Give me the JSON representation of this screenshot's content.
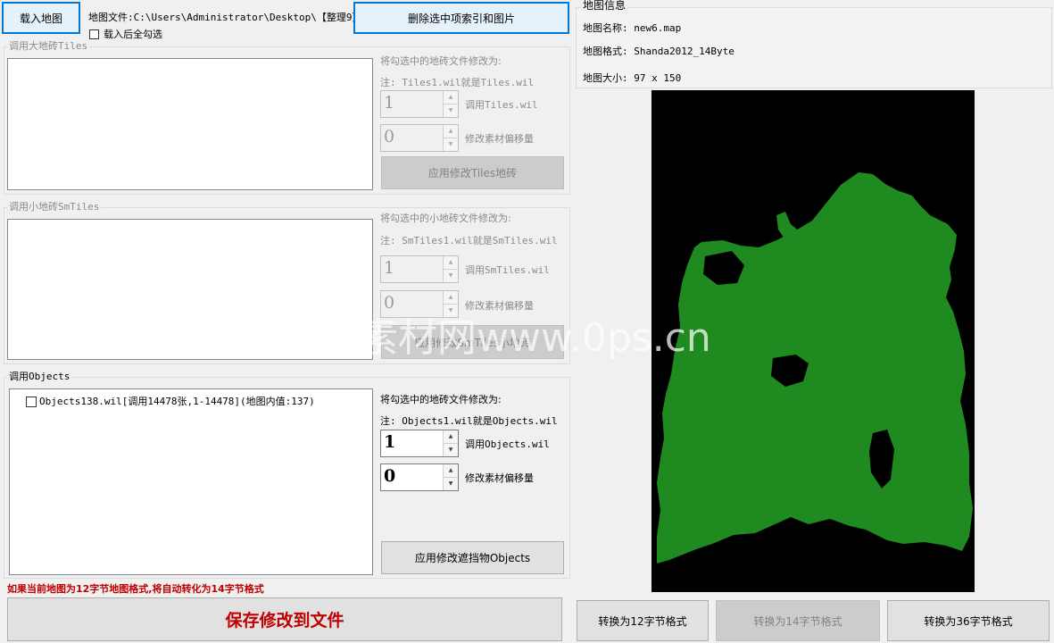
{
  "toolbar": {
    "load_map_label": "载入地图",
    "map_file_label": "地图文件:C:\\Users\\Administrator\\Desktop\\【整理9】:",
    "delete_label": "删除选中项索引和图片",
    "select_all_label": "载入后全勾选"
  },
  "tiles": {
    "legend": "调用大地砖Tiles",
    "modify_label": "将勾选中的地砖文件修改为:",
    "note": "注: Tiles1.wil就是Tiles.wil",
    "index_value": "1",
    "index_label": "调用Tiles.wil",
    "offset_value": "0",
    "offset_label": "修改素材偏移量",
    "apply_label": "应用修改Tiles地砖"
  },
  "smtiles": {
    "legend": "调用小地砖SmTiles",
    "modify_label": "将勾选中的小地砖文件修改为:",
    "note": "注: SmTiles1.wil就是SmTiles.wil",
    "index_value": "1",
    "index_label": "调用SmTiles.wil",
    "offset_value": "0",
    "offset_label": "修改素材偏移量",
    "apply_label": "应用修改SmTiles小地砖"
  },
  "objects": {
    "legend": "调用Objects",
    "items": [
      {
        "label": "Objects138.wil[调用14478张,1-14478](地图内值:137)",
        "checked": false
      }
    ],
    "modify_label": "将勾选中的地砖文件修改为:",
    "note": "注: Objects1.wil就是Objects.wil",
    "index_value": "1",
    "index_label": "调用Objects.wil",
    "offset_value": "0",
    "offset_label": "修改素材偏移量",
    "apply_label": "应用修改遮挡物Objects"
  },
  "footer": {
    "warning": "如果当前地图为12字节地图格式,将自动转化为14字节格式",
    "save_label": "保存修改到文件"
  },
  "info": {
    "legend": "地图信息",
    "name": "地图名称: new6.map",
    "format": "地图格式: Shanda2012_14Byte",
    "size": "地图大小: 97 x 150"
  },
  "convert": {
    "btn12": "转换为12字节格式",
    "btn14": "转换为14字节格式",
    "btn36": "转换为36字节格式"
  },
  "watermark": "素材网www.0ps.cn",
  "colors": {
    "map_bg": "#000000",
    "map_land": "#1f8a1f",
    "warning": "#c00000",
    "focus": "#0078d7"
  }
}
